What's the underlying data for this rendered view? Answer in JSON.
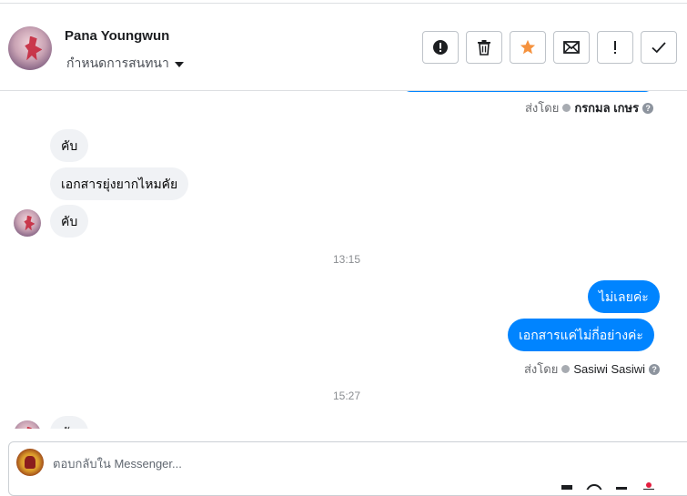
{
  "header": {
    "contact_name": "Pana Youngwun",
    "label_dropdown": "กำหนดการสนทนา",
    "tools": [
      {
        "icon": "alert-circle-icon",
        "name": "spam-button"
      },
      {
        "icon": "trash-icon",
        "name": "delete-button"
      },
      {
        "icon": "star-icon",
        "name": "follow-up-button"
      },
      {
        "icon": "envelope-icon",
        "name": "mark-unread-button"
      },
      {
        "icon": "exclamation-icon",
        "name": "priority-button"
      },
      {
        "icon": "checkmark-icon",
        "name": "mark-done-button"
      }
    ]
  },
  "messages": {
    "sent_by_1": {
      "prefix": "ส่งโดย",
      "agent": "กรกมล เกษร"
    },
    "incoming": [
      "คับ",
      "เอกสารยุ่งยากไหมคัย",
      "คับ"
    ],
    "time_1": "13:15",
    "outgoing": [
      "ไม่เลยค่ะ",
      "เอกสารแค่ไม่กี่อย่างค่ะ"
    ],
    "sent_by_2": {
      "prefix": "ส่งโดย",
      "agent": "Sasiwi Sasiwi"
    },
    "time_2": "15:27",
    "partial_incoming": "คับ"
  },
  "composer": {
    "placeholder": "ตอบกลับใน Messenger..."
  },
  "colors": {
    "outgoing_bubble": "#0084ff",
    "incoming_bubble": "#f0f2f5",
    "star": "#f5923e"
  }
}
